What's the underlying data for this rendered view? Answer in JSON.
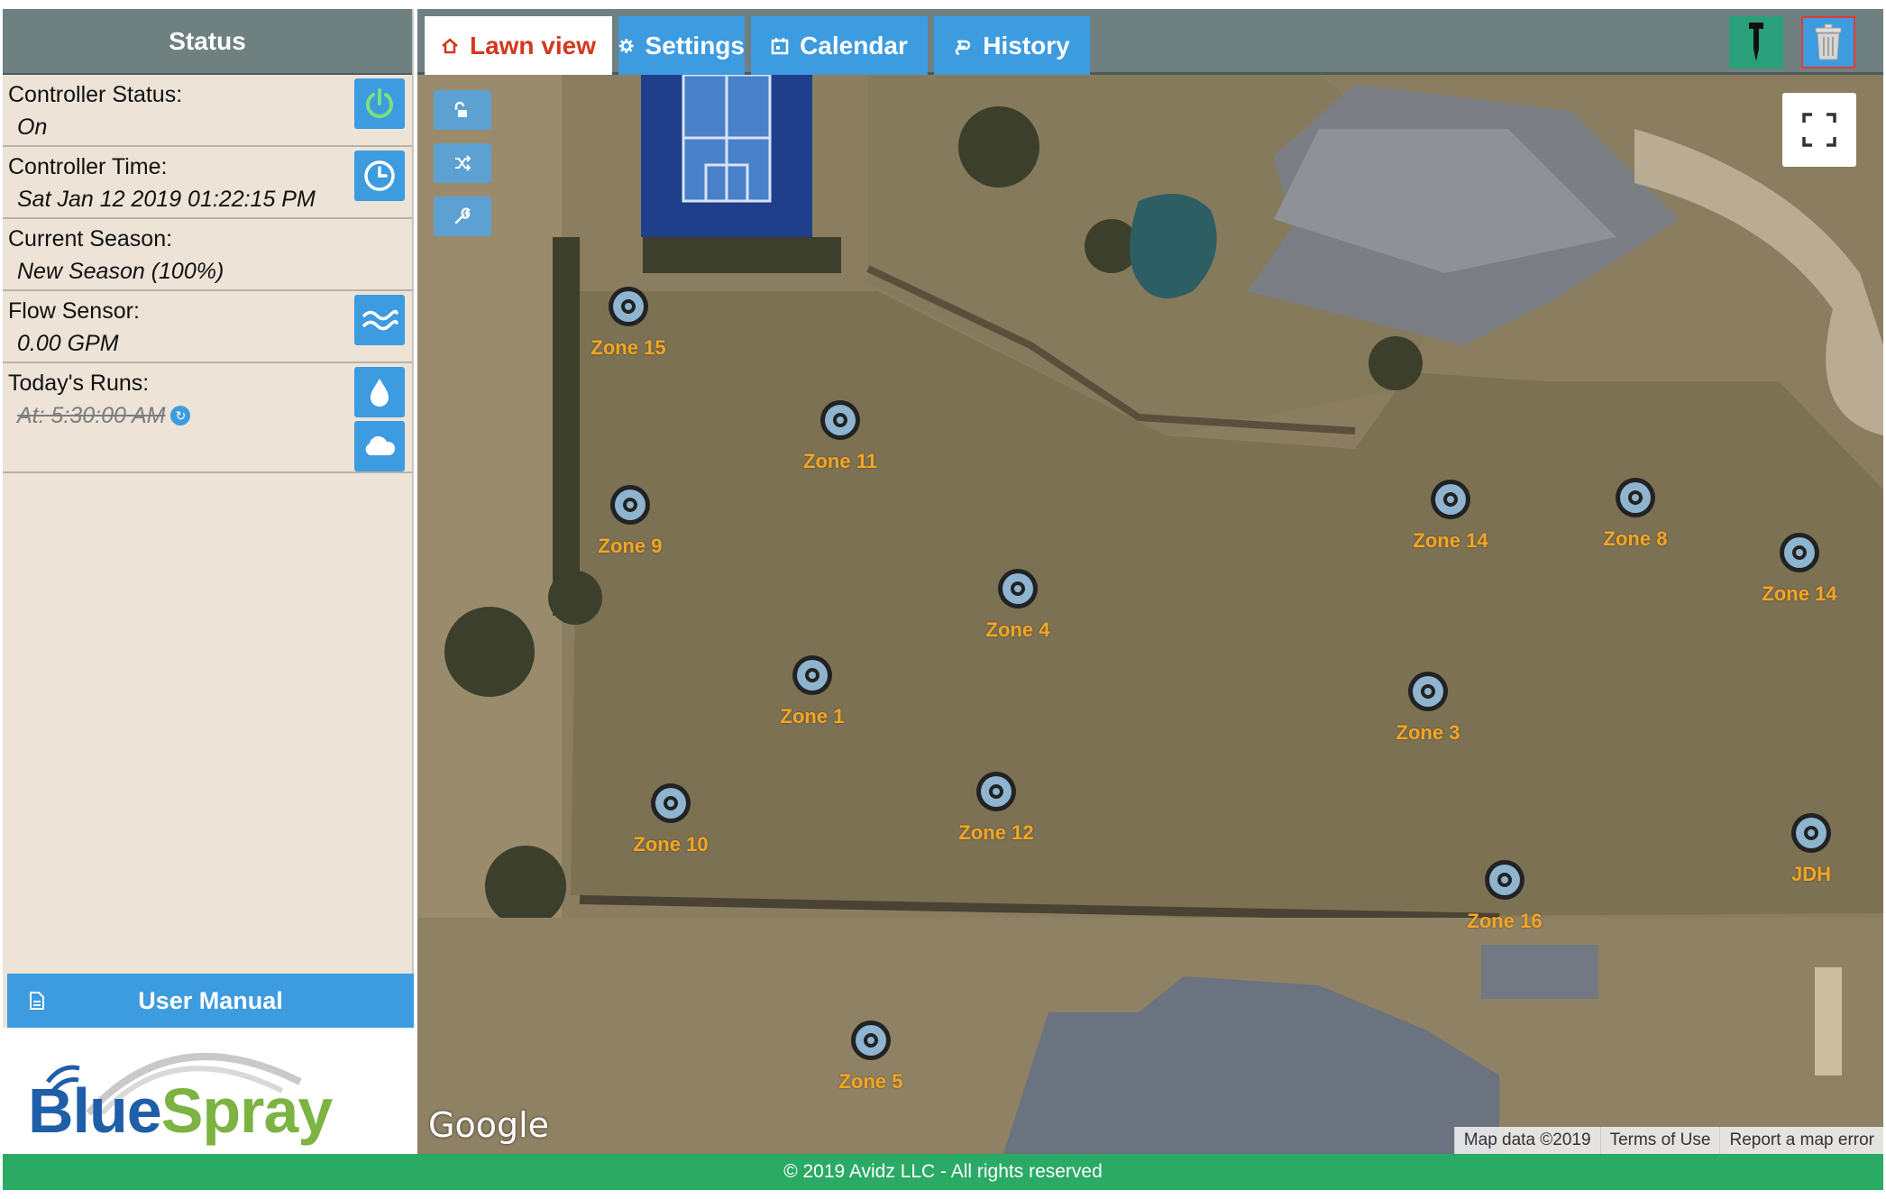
{
  "sidebar": {
    "header": "Status",
    "controller_status": {
      "label": "Controller Status:",
      "value": "On",
      "icon": "power-icon"
    },
    "controller_time": {
      "label": "Controller Time:",
      "value": "Sat Jan 12 2019 01:22:15 PM",
      "icon": "clock-icon"
    },
    "current_season": {
      "label": "Current Season:",
      "value": "New Season (100%)"
    },
    "flow_sensor": {
      "label": "Flow Sensor:",
      "value": "0.00 GPM",
      "icon": "waves-icon"
    },
    "todays_runs": {
      "label": "Today's Runs:",
      "value": "At: 5:30:00 AM",
      "icons": [
        "water-drop-icon",
        "cloud-icon"
      ]
    },
    "user_manual": "User Manual",
    "logo": {
      "part1": "Blue",
      "part2": "Spray"
    }
  },
  "tabs": [
    {
      "label": "Lawn view",
      "icon": "home-icon",
      "active": true
    },
    {
      "label": "Settings",
      "icon": "gear-icon",
      "active": false
    },
    {
      "label": "Calendar",
      "icon": "calendar-icon",
      "active": false
    },
    {
      "label": "History",
      "icon": "history-icon",
      "active": false
    }
  ],
  "toolbar": {
    "add_sprinkler_icon": "sprinkler-icon",
    "delete_icon": "trash-icon"
  },
  "map": {
    "zones": [
      {
        "label": "Zone 15"
      },
      {
        "label": "Zone 11"
      },
      {
        "label": "Zone 9"
      },
      {
        "label": "Zone 14"
      },
      {
        "label": "Zone 8"
      },
      {
        "label": "Zone 14"
      },
      {
        "label": "Zone 4"
      },
      {
        "label": "Zone 1"
      },
      {
        "label": "Zone 3"
      },
      {
        "label": "Zone 10"
      },
      {
        "label": "Zone 12"
      },
      {
        "label": "JDH"
      },
      {
        "label": "Zone 16"
      },
      {
        "label": "Zone 5"
      }
    ],
    "google_label": "Google",
    "attribution": [
      "Map data ©2019",
      "Terms of Use",
      "Report a map error"
    ]
  },
  "footer": "© 2019 Avidz LLC - All rights reserved",
  "colors": {
    "header_gray": "#6f8081",
    "accent_blue": "#3d9be0",
    "active_tab_text": "#d4381e",
    "zone_label": "#f5a623",
    "footer_green": "#2aaa64",
    "sidebar_bg": "#ede3d6"
  }
}
